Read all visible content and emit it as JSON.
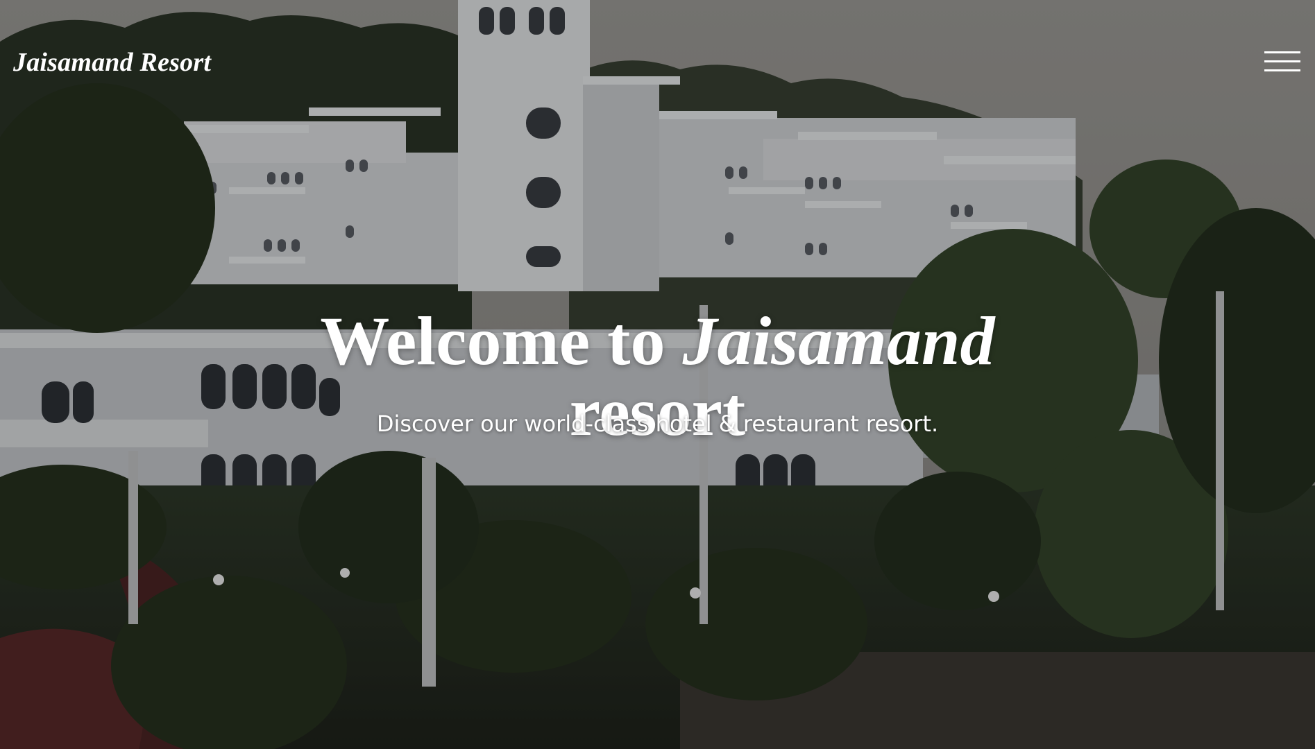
{
  "header": {
    "brand": "Jaisamand Resort",
    "menu_icon": "hamburger-menu-icon"
  },
  "hero": {
    "title_prefix": "Welcome to ",
    "title_emphasis": "Jaisamand",
    "title_suffix": "resort",
    "subtitle": "Discover our world-class hotel & restaurant resort."
  },
  "colors": {
    "text": "#ffffff",
    "sky": "#a8a7a3",
    "building": "#e6e8ea",
    "foliage": "#2b3528"
  }
}
